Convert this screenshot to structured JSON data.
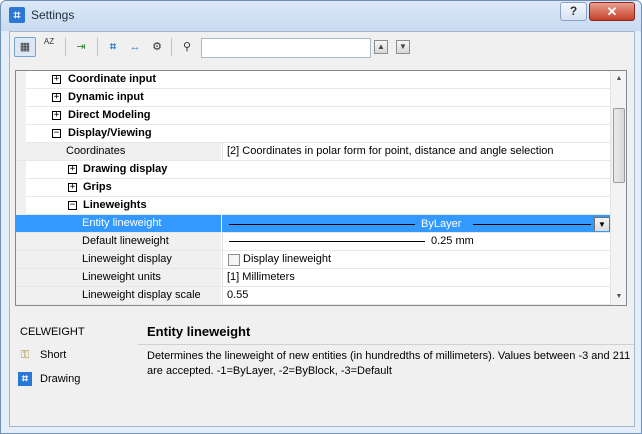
{
  "window": {
    "title": "Settings",
    "help_label": "?",
    "close_label": "✕"
  },
  "toolbar": {
    "buttons": [
      {
        "name": "categorized-view-icon",
        "glyph": "▦"
      },
      {
        "name": "alphabetical-sort-icon",
        "glyph": "AZ"
      },
      {
        "name": "export-icon",
        "glyph": "⇥"
      },
      {
        "name": "drawing-settings-icon",
        "glyph": "⌗"
      },
      {
        "name": "dimension-icon",
        "glyph": "↔"
      },
      {
        "name": "options-gear-icon",
        "glyph": "⚙"
      },
      {
        "name": "find-binoculars-icon",
        "glyph": "⚲"
      }
    ],
    "search_value": "",
    "prev_glyph": "▲",
    "next_glyph": "▼"
  },
  "tree": {
    "coordinate_input": "Coordinate input",
    "dynamic_input": "Dynamic input",
    "direct_modeling": "Direct Modeling",
    "display_viewing": "Display/Viewing",
    "coordinates_label": "Coordinates",
    "coordinates_value": "[2] Coordinates in polar form for point, distance and angle selection",
    "drawing_display": "Drawing display",
    "grips": "Grips",
    "lineweights": "Lineweights",
    "entity_lineweight_label": "Entity lineweight",
    "entity_lineweight_value": "ByLayer",
    "default_lineweight_label": "Default lineweight",
    "default_lineweight_value": "0.25 mm",
    "lineweight_display_label": "Lineweight display",
    "lineweight_display_value": "Display lineweight",
    "lineweight_units_label": "Lineweight units",
    "lineweight_units_value": "[1] Millimeters",
    "lineweight_scale_label": "Lineweight display scale",
    "lineweight_scale_value": "0.55",
    "expand_glyph": "+",
    "collapse_glyph": "−",
    "dropdown_glyph": "▼"
  },
  "info": {
    "variable": "CELWEIGHT",
    "short_label": "Short",
    "drawing_label": "Drawing",
    "title": "Entity lineweight",
    "description": "Determines the lineweight of new entities (in hundredths of millimeters). Values between -3 and 211 are accepted. -1=ByLayer, -2=ByBlock, -3=Default"
  },
  "colors": {
    "selection": "#3399ff",
    "window_frame": "#c9dbf1",
    "close": "#c7402a"
  }
}
